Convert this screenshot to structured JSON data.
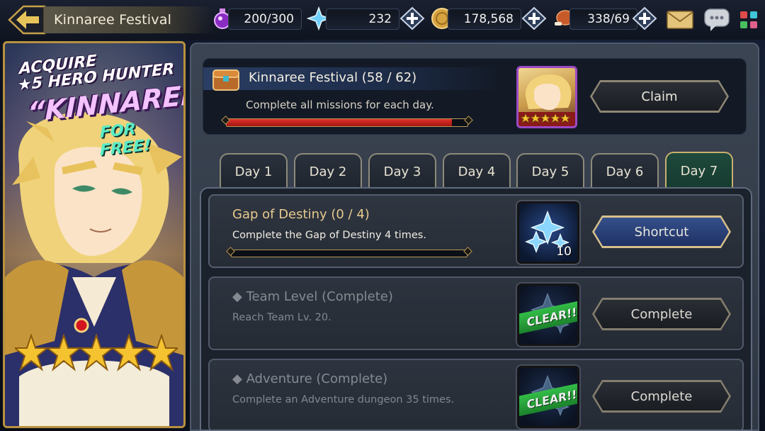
{
  "header": {
    "title": "Kinnaree Festival",
    "resources": [
      {
        "name": "stamina",
        "icon": "stamina-potion-icon",
        "value": "200/300"
      },
      {
        "name": "crystals",
        "icon": "crystal-icon",
        "value": "232"
      },
      {
        "name": "gold",
        "icon": "gold-coin-icon",
        "value": "178,568"
      },
      {
        "name": "meat",
        "icon": "meat-icon",
        "value": "338/69"
      }
    ]
  },
  "banner": {
    "line1": "ACQUIRE",
    "line2": "★5 HERO HUNTER",
    "line3": "“KINNAREE”",
    "line4": "FOR FREE!",
    "hero_stars": 5
  },
  "festival": {
    "title": "Kinnaree Festival (58 / 62)",
    "description": "Complete all missions for each day.",
    "progress_current": 58,
    "progress_total": 62,
    "claim_label": "Claim"
  },
  "tabs": [
    "Day 1",
    "Day 2",
    "Day 3",
    "Day 4",
    "Day 5",
    "Day 6",
    "Day 7"
  ],
  "active_tab": "Day 7",
  "missions": [
    {
      "title": "Gap of Destiny (0 / 4)",
      "description": "Complete the Gap of Destiny 4 times.",
      "progress_current": 0,
      "progress_total": 4,
      "reward_icon": "crystal-bundle-icon",
      "reward_count": "10",
      "button_label": "Shortcut",
      "status": "in-progress"
    },
    {
      "title": "◆ Team Level (Complete)",
      "description": "Reach Team Lv. 20.",
      "reward_icon": "crystal-bundle-icon",
      "badge": "CLEAR!!",
      "button_label": "Complete",
      "status": "complete"
    },
    {
      "title": "◆ Adventure (Complete)",
      "description": "Complete an Adventure dungeon 35 times.",
      "reward_icon": "crystal-bundle-icon",
      "badge": "CLEAR!!",
      "button_label": "Complete",
      "status": "complete"
    }
  ],
  "colors": {
    "accent_gold": "#c9b06e",
    "progress_red": "#d42a22",
    "clear_green": "#2fb842",
    "shortcut_blue": "#2a4380",
    "hero_frame_purple": "#9b4ac4"
  }
}
